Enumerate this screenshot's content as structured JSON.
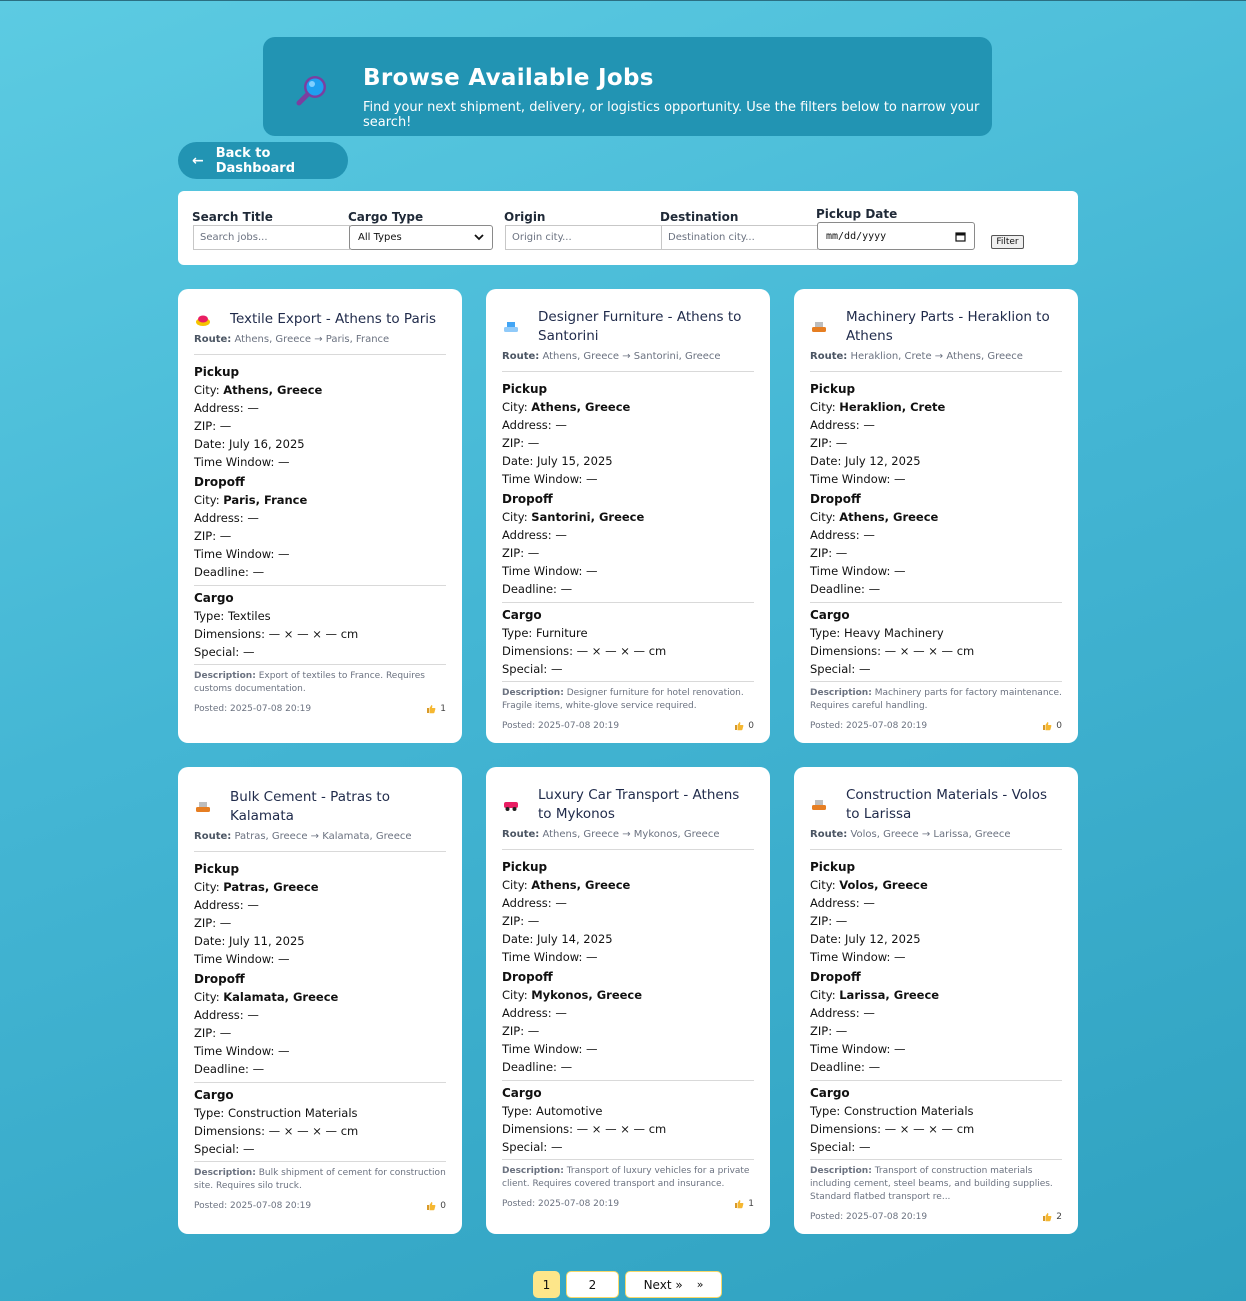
{
  "hero": {
    "title": "Browse Available Jobs",
    "subtitle": "Find your next shipment, delivery, or logistics opportunity. Use the filters below to narrow your search!"
  },
  "back_button": {
    "label": "Back to Dashboard",
    "arrow": "←"
  },
  "filters": {
    "search_title": {
      "label": "Search Title",
      "placeholder": "Search jobs..."
    },
    "cargo_type": {
      "label": "Cargo Type",
      "value": "All Types"
    },
    "origin": {
      "label": "Origin",
      "placeholder": "Origin city..."
    },
    "destination": {
      "label": "Destination",
      "placeholder": "Destination city..."
    },
    "pickup_date": {
      "label": "Pickup Date",
      "placeholder": "mm/dd/yyyy"
    },
    "filter_button": "Filter"
  },
  "labels": {
    "route": "Route:",
    "pickup": "Pickup",
    "dropoff": "Dropoff",
    "cargo": "Cargo",
    "city": "City:",
    "address": "Address:",
    "zip": "ZIP:",
    "date": "Date:",
    "time_window": "Time Window:",
    "deadline": "Deadline:",
    "type": "Type:",
    "dimensions": "Dimensions:",
    "special": "Special:",
    "description": "Description:",
    "posted": "Posted:"
  },
  "jobs": [
    {
      "title": "Textile Export - Athens to Paris",
      "icon": "textile-icon",
      "icon_color": "#e91e63",
      "route": "Athens, Greece → Paris, France",
      "pickup": {
        "city": "Athens, Greece",
        "address": "—",
        "zip": "—",
        "date": "July 16, 2025",
        "time_window": "—"
      },
      "dropoff": {
        "city": "Paris, France",
        "address": "—",
        "zip": "—",
        "time_window": "—",
        "deadline": "—"
      },
      "cargo": {
        "type": "Textiles",
        "dimensions": "— × — × — cm",
        "special": "—"
      },
      "description": "Export of textiles to France. Requires customs documentation.",
      "posted": "2025-07-08 20:19",
      "likes": "1"
    },
    {
      "title": "Designer Furniture - Athens to Santorini",
      "icon": "furniture-icon",
      "icon_color": "#42a5f5",
      "route": "Athens, Greece → Santorini, Greece",
      "pickup": {
        "city": "Athens, Greece",
        "address": "—",
        "zip": "—",
        "date": "July 15, 2025",
        "time_window": "—"
      },
      "dropoff": {
        "city": "Santorini, Greece",
        "address": "—",
        "zip": "—",
        "time_window": "—",
        "deadline": "—"
      },
      "cargo": {
        "type": "Furniture",
        "dimensions": "— × — × — cm",
        "special": "—"
      },
      "description": "Designer furniture for hotel renovation. Fragile items, white-glove service required.",
      "posted": "2025-07-08 20:19",
      "likes": "0"
    },
    {
      "title": "Machinery Parts - Heraklion to Athens",
      "icon": "machinery-icon",
      "icon_color": "#e67e22",
      "route": "Heraklion, Crete → Athens, Greece",
      "pickup": {
        "city": "Heraklion, Crete",
        "address": "—",
        "zip": "—",
        "date": "July 12, 2025",
        "time_window": "—"
      },
      "dropoff": {
        "city": "Athens, Greece",
        "address": "—",
        "zip": "—",
        "time_window": "—",
        "deadline": "—"
      },
      "cargo": {
        "type": "Heavy Machinery",
        "dimensions": "— × — × — cm",
        "special": "—"
      },
      "description": "Machinery parts for factory maintenance. Requires careful handling.",
      "posted": "2025-07-08 20:19",
      "likes": "0"
    },
    {
      "title": "Bulk Cement - Patras to Kalamata",
      "icon": "construction-icon",
      "icon_color": "#e67e22",
      "route": "Patras, Greece → Kalamata, Greece",
      "pickup": {
        "city": "Patras, Greece",
        "address": "—",
        "zip": "—",
        "date": "July 11, 2025",
        "time_window": "—"
      },
      "dropoff": {
        "city": "Kalamata, Greece",
        "address": "—",
        "zip": "—",
        "time_window": "—",
        "deadline": "—"
      },
      "cargo": {
        "type": "Construction Materials",
        "dimensions": "— × — × — cm",
        "special": "—"
      },
      "description": "Bulk shipment of cement for construction site. Requires silo truck.",
      "posted": "2025-07-08 20:19",
      "likes": "0"
    },
    {
      "title": "Luxury Car Transport - Athens to Mykonos",
      "icon": "car-icon",
      "icon_color": "#e91e63",
      "route": "Athens, Greece → Mykonos, Greece",
      "pickup": {
        "city": "Athens, Greece",
        "address": "—",
        "zip": "—",
        "date": "July 14, 2025",
        "time_window": "—"
      },
      "dropoff": {
        "city": "Mykonos, Greece",
        "address": "—",
        "zip": "—",
        "time_window": "—",
        "deadline": "—"
      },
      "cargo": {
        "type": "Automotive",
        "dimensions": "— × — × — cm",
        "special": "—"
      },
      "description": "Transport of luxury vehicles for a private client. Requires covered transport and insurance.",
      "posted": "2025-07-08 20:19",
      "likes": "1"
    },
    {
      "title": "Construction Materials - Volos to Larissa",
      "icon": "construction-icon",
      "icon_color": "#e67e22",
      "route": "Volos, Greece → Larissa, Greece",
      "pickup": {
        "city": "Volos, Greece",
        "address": "—",
        "zip": "—",
        "date": "July 12, 2025",
        "time_window": "—"
      },
      "dropoff": {
        "city": "Larissa, Greece",
        "address": "—",
        "zip": "—",
        "time_window": "—",
        "deadline": "—"
      },
      "cargo": {
        "type": "Construction Materials",
        "dimensions": "— × — × — cm",
        "special": "—"
      },
      "description": "Transport of construction materials including cement, steel beams, and building supplies. Standard flatbed transport re...",
      "posted": "2025-07-08 20:19",
      "likes": "2"
    }
  ],
  "pagination": {
    "pages": [
      "1",
      "2"
    ],
    "current": "1",
    "next_label": "Next »",
    "next_arrow": "»"
  }
}
